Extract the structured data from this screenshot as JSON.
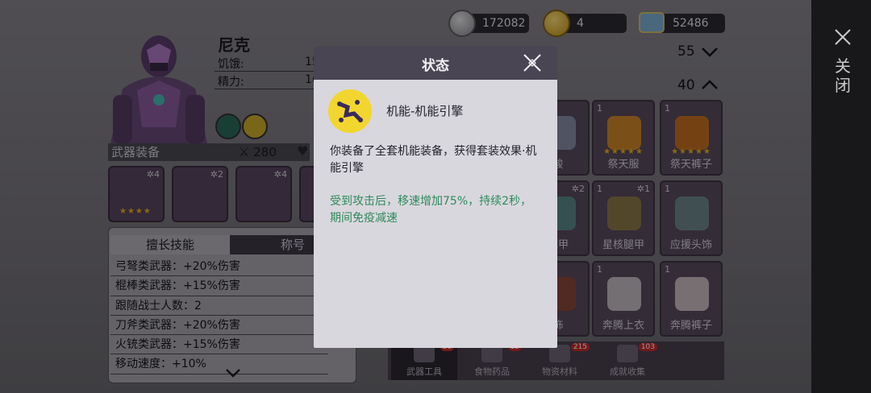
{
  "currencies": {
    "silver": "172082",
    "gold": "4",
    "ticket": "52486"
  },
  "character": {
    "name": "尼克",
    "stats": [
      {
        "label": "饥饿:",
        "value": "15"
      },
      {
        "label": "精力:",
        "value": "1("
      }
    ]
  },
  "equipment": {
    "title": "武器装备",
    "power": "280",
    "slots": [
      {
        "level": "4",
        "stars": "★★★★"
      },
      {
        "level": "2"
      },
      {
        "level": "4"
      },
      {}
    ]
  },
  "skills": {
    "tabs": [
      "擅长技能",
      "称号"
    ],
    "items": [
      "弓弩类武器：+20%伤害",
      "棍棒类武器：+15%伤害",
      "跟随战士人数：2",
      "刀斧类武器：+20%伤害",
      "火铳类武器：+15%伤害",
      "移动速度：+10%"
    ]
  },
  "inventory_header": {
    "value_1": "55",
    "value_2": "40"
  },
  "inventory": [
    {
      "count": "",
      "level": "",
      "name": "骏",
      "stars": ""
    },
    {
      "count": "1",
      "level": "",
      "name": "祭天服",
      "stars": "★★★★★"
    },
    {
      "count": "1",
      "level": "",
      "name": "祭天裤子",
      "stars": "★★★★★"
    },
    {
      "count": "",
      "level": "2",
      "name": "铠甲",
      "stars": ""
    },
    {
      "count": "1",
      "level": "1",
      "name": "星核腿甲",
      "stars": ""
    },
    {
      "count": "1",
      "level": "",
      "name": "应援头饰",
      "stars": ""
    },
    {
      "count": "",
      "level": "",
      "name": "饰",
      "stars": ""
    },
    {
      "count": "1",
      "level": "",
      "name": "奔腾上衣",
      "stars": ""
    },
    {
      "count": "1",
      "level": "",
      "name": "奔腾裤子",
      "stars": ""
    }
  ],
  "bottom_tabs": [
    {
      "label": "武器工具",
      "badge": "36"
    },
    {
      "label": "食物药品",
      "badge": "15"
    },
    {
      "label": "物资材料",
      "badge": "215"
    },
    {
      "label": "成就收集",
      "badge": "103"
    }
  ],
  "side": {
    "close_label": "关闭"
  },
  "modal": {
    "title": "状态",
    "effect_name": "机能-机能引擎",
    "description": "你装备了全套机能装备，获得套装效果·机能引擎",
    "detail": "受到攻击后，移速增加75%，持续2秒，期间免疫减速"
  },
  "colors": {
    "modal_header": "#4a4553",
    "modal_body": "#d9d7de",
    "detail_text": "#2e8a5a",
    "effect_icon": "#f2d62f"
  }
}
